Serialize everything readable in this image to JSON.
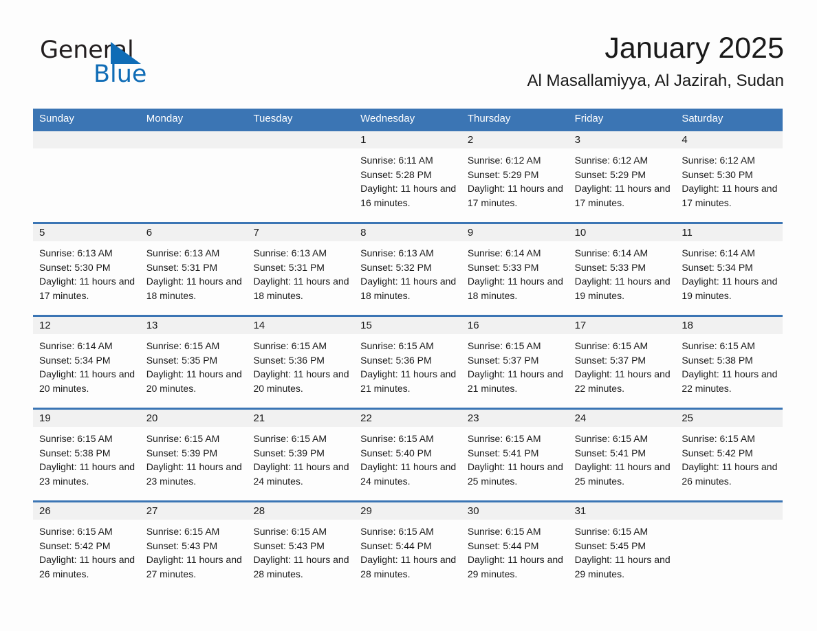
{
  "brand": {
    "name_part1": "General",
    "name_part2": "Blue",
    "triangle_icon": "triangle-logo-icon",
    "accent_color": "#0f6cb6"
  },
  "header": {
    "title": "January 2025",
    "subtitle": "Al Masallamiyya, Al Jazirah, Sudan"
  },
  "theme": {
    "header_blue": "#3b75b4",
    "daynum_band": "#f1f1f1",
    "text": "#1a1a1a"
  },
  "calendar": {
    "weekday_headers": [
      "Sunday",
      "Monday",
      "Tuesday",
      "Wednesday",
      "Thursday",
      "Friday",
      "Saturday"
    ],
    "weeks": [
      [
        {
          "day": "",
          "sunrise": "",
          "sunset": "",
          "daylight": ""
        },
        {
          "day": "",
          "sunrise": "",
          "sunset": "",
          "daylight": ""
        },
        {
          "day": "",
          "sunrise": "",
          "sunset": "",
          "daylight": ""
        },
        {
          "day": "1",
          "sunrise": "Sunrise: 6:11 AM",
          "sunset": "Sunset: 5:28 PM",
          "daylight": "Daylight: 11 hours and 16 minutes."
        },
        {
          "day": "2",
          "sunrise": "Sunrise: 6:12 AM",
          "sunset": "Sunset: 5:29 PM",
          "daylight": "Daylight: 11 hours and 17 minutes."
        },
        {
          "day": "3",
          "sunrise": "Sunrise: 6:12 AM",
          "sunset": "Sunset: 5:29 PM",
          "daylight": "Daylight: 11 hours and 17 minutes."
        },
        {
          "day": "4",
          "sunrise": "Sunrise: 6:12 AM",
          "sunset": "Sunset: 5:30 PM",
          "daylight": "Daylight: 11 hours and 17 minutes."
        }
      ],
      [
        {
          "day": "5",
          "sunrise": "Sunrise: 6:13 AM",
          "sunset": "Sunset: 5:30 PM",
          "daylight": "Daylight: 11 hours and 17 minutes."
        },
        {
          "day": "6",
          "sunrise": "Sunrise: 6:13 AM",
          "sunset": "Sunset: 5:31 PM",
          "daylight": "Daylight: 11 hours and 18 minutes."
        },
        {
          "day": "7",
          "sunrise": "Sunrise: 6:13 AM",
          "sunset": "Sunset: 5:31 PM",
          "daylight": "Daylight: 11 hours and 18 minutes."
        },
        {
          "day": "8",
          "sunrise": "Sunrise: 6:13 AM",
          "sunset": "Sunset: 5:32 PM",
          "daylight": "Daylight: 11 hours and 18 minutes."
        },
        {
          "day": "9",
          "sunrise": "Sunrise: 6:14 AM",
          "sunset": "Sunset: 5:33 PM",
          "daylight": "Daylight: 11 hours and 18 minutes."
        },
        {
          "day": "10",
          "sunrise": "Sunrise: 6:14 AM",
          "sunset": "Sunset: 5:33 PM",
          "daylight": "Daylight: 11 hours and 19 minutes."
        },
        {
          "day": "11",
          "sunrise": "Sunrise: 6:14 AM",
          "sunset": "Sunset: 5:34 PM",
          "daylight": "Daylight: 11 hours and 19 minutes."
        }
      ],
      [
        {
          "day": "12",
          "sunrise": "Sunrise: 6:14 AM",
          "sunset": "Sunset: 5:34 PM",
          "daylight": "Daylight: 11 hours and 20 minutes."
        },
        {
          "day": "13",
          "sunrise": "Sunrise: 6:15 AM",
          "sunset": "Sunset: 5:35 PM",
          "daylight": "Daylight: 11 hours and 20 minutes."
        },
        {
          "day": "14",
          "sunrise": "Sunrise: 6:15 AM",
          "sunset": "Sunset: 5:36 PM",
          "daylight": "Daylight: 11 hours and 20 minutes."
        },
        {
          "day": "15",
          "sunrise": "Sunrise: 6:15 AM",
          "sunset": "Sunset: 5:36 PM",
          "daylight": "Daylight: 11 hours and 21 minutes."
        },
        {
          "day": "16",
          "sunrise": "Sunrise: 6:15 AM",
          "sunset": "Sunset: 5:37 PM",
          "daylight": "Daylight: 11 hours and 21 minutes."
        },
        {
          "day": "17",
          "sunrise": "Sunrise: 6:15 AM",
          "sunset": "Sunset: 5:37 PM",
          "daylight": "Daylight: 11 hours and 22 minutes."
        },
        {
          "day": "18",
          "sunrise": "Sunrise: 6:15 AM",
          "sunset": "Sunset: 5:38 PM",
          "daylight": "Daylight: 11 hours and 22 minutes."
        }
      ],
      [
        {
          "day": "19",
          "sunrise": "Sunrise: 6:15 AM",
          "sunset": "Sunset: 5:38 PM",
          "daylight": "Daylight: 11 hours and 23 minutes."
        },
        {
          "day": "20",
          "sunrise": "Sunrise: 6:15 AM",
          "sunset": "Sunset: 5:39 PM",
          "daylight": "Daylight: 11 hours and 23 minutes."
        },
        {
          "day": "21",
          "sunrise": "Sunrise: 6:15 AM",
          "sunset": "Sunset: 5:39 PM",
          "daylight": "Daylight: 11 hours and 24 minutes."
        },
        {
          "day": "22",
          "sunrise": "Sunrise: 6:15 AM",
          "sunset": "Sunset: 5:40 PM",
          "daylight": "Daylight: 11 hours and 24 minutes."
        },
        {
          "day": "23",
          "sunrise": "Sunrise: 6:15 AM",
          "sunset": "Sunset: 5:41 PM",
          "daylight": "Daylight: 11 hours and 25 minutes."
        },
        {
          "day": "24",
          "sunrise": "Sunrise: 6:15 AM",
          "sunset": "Sunset: 5:41 PM",
          "daylight": "Daylight: 11 hours and 25 minutes."
        },
        {
          "day": "25",
          "sunrise": "Sunrise: 6:15 AM",
          "sunset": "Sunset: 5:42 PM",
          "daylight": "Daylight: 11 hours and 26 minutes."
        }
      ],
      [
        {
          "day": "26",
          "sunrise": "Sunrise: 6:15 AM",
          "sunset": "Sunset: 5:42 PM",
          "daylight": "Daylight: 11 hours and 26 minutes."
        },
        {
          "day": "27",
          "sunrise": "Sunrise: 6:15 AM",
          "sunset": "Sunset: 5:43 PM",
          "daylight": "Daylight: 11 hours and 27 minutes."
        },
        {
          "day": "28",
          "sunrise": "Sunrise: 6:15 AM",
          "sunset": "Sunset: 5:43 PM",
          "daylight": "Daylight: 11 hours and 28 minutes."
        },
        {
          "day": "29",
          "sunrise": "Sunrise: 6:15 AM",
          "sunset": "Sunset: 5:44 PM",
          "daylight": "Daylight: 11 hours and 28 minutes."
        },
        {
          "day": "30",
          "sunrise": "Sunrise: 6:15 AM",
          "sunset": "Sunset: 5:44 PM",
          "daylight": "Daylight: 11 hours and 29 minutes."
        },
        {
          "day": "31",
          "sunrise": "Sunrise: 6:15 AM",
          "sunset": "Sunset: 5:45 PM",
          "daylight": "Daylight: 11 hours and 29 minutes."
        },
        {
          "day": "",
          "sunrise": "",
          "sunset": "",
          "daylight": ""
        }
      ]
    ]
  }
}
